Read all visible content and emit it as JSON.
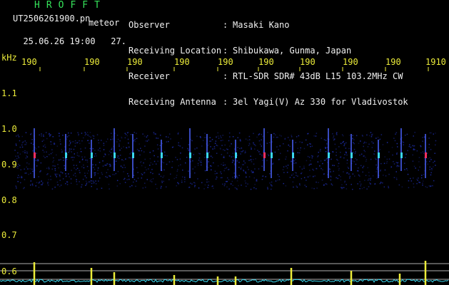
{
  "header": {
    "app_title": "HROFFT",
    "file_name": "UT2506261900.pn",
    "meteor_label": "meteor",
    "date": "25.06.26",
    "time": "19:00",
    "count": "27.",
    "info_labels": [
      "Observer",
      "Receiving Location",
      "Receiver",
      "Receiving Antenna"
    ],
    "info_separator": ":",
    "info_values": [
      "Masaki Kano",
      "Shibukawa, Gunma, Japan",
      "RTL-SDR SDR# 43dB L15 103.2MHz CW",
      "3el Yagi(V) Az 330 for Vladivostok"
    ]
  },
  "axis": {
    "y_unit": "kHz",
    "y_ticks": [
      "1.1",
      "1.0",
      "0.9",
      "0.8",
      "0.7",
      "0.6"
    ],
    "x_ticks": [
      "190",
      "190",
      "190",
      "190",
      "190",
      "190",
      "190",
      "190",
      "190",
      "1910"
    ]
  },
  "colors": {
    "background": "#000000",
    "text_green": "#35e35a",
    "text_white": "#f0f0f0",
    "text_yellow": "#ecec3a",
    "noise_blue": "#1f2fb0",
    "echo_red": "#ff3060",
    "baseline_cyan": "#3ad8f0"
  }
}
